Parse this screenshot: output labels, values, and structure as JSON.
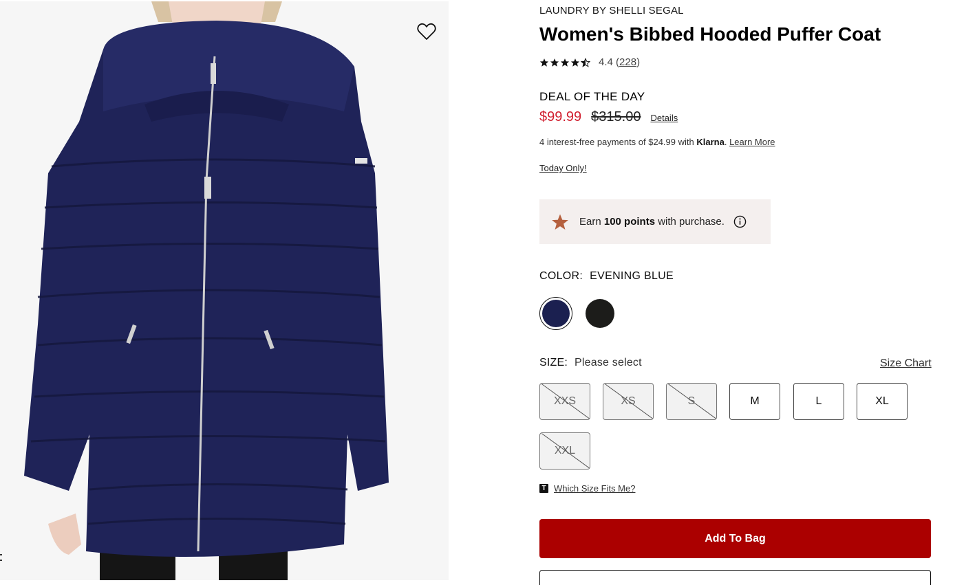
{
  "product": {
    "brand": "LAUNDRY BY SHELLI SEGAL",
    "title": "Women's Bibbed Hooded Puffer Coat",
    "rating": {
      "stars": 4.4,
      "value_text": "4.4",
      "open_paren": "(",
      "review_count": "228",
      "close_paren": ")"
    }
  },
  "deal": {
    "label": "DEAL OF THE DAY",
    "sale_price": "$99.99",
    "original_price": "$315.00",
    "details_link": "Details"
  },
  "klarna": {
    "prefix": "4 interest-free payments of $24.99 with ",
    "brand": "Klarna",
    "period": ". ",
    "learn_more": "Learn More"
  },
  "today_only": "Today Only!",
  "points": {
    "earn": "Earn ",
    "amount": "100 points",
    "suffix": " with purchase.",
    "icon": "info-icon",
    "star_color": "#b5603e",
    "bg_color": "#f4efee"
  },
  "color": {
    "label": "COLOR:",
    "selected": "EVENING BLUE",
    "swatches": [
      {
        "name": "Evening Blue",
        "hex": "#1b2050",
        "selected": true
      },
      {
        "name": "Black",
        "hex": "#1c1c1a",
        "selected": false
      }
    ]
  },
  "size": {
    "label": "SIZE:",
    "selected": "Please select",
    "chart_link": "Size Chart",
    "options": [
      {
        "label": "XXS",
        "available": false
      },
      {
        "label": "XS",
        "available": false
      },
      {
        "label": "S",
        "available": false
      },
      {
        "label": "M",
        "available": true
      },
      {
        "label": "L",
        "available": true
      },
      {
        "label": "XL",
        "available": true
      },
      {
        "label": "XXL",
        "available": false
      }
    ]
  },
  "fit": {
    "icon_text": "T",
    "link": "Which Size Fits Me?"
  },
  "actions": {
    "add_to_bag": "Add To Bag",
    "primary_color": "#ab0000"
  },
  "wishlist_icon": "heart-icon"
}
